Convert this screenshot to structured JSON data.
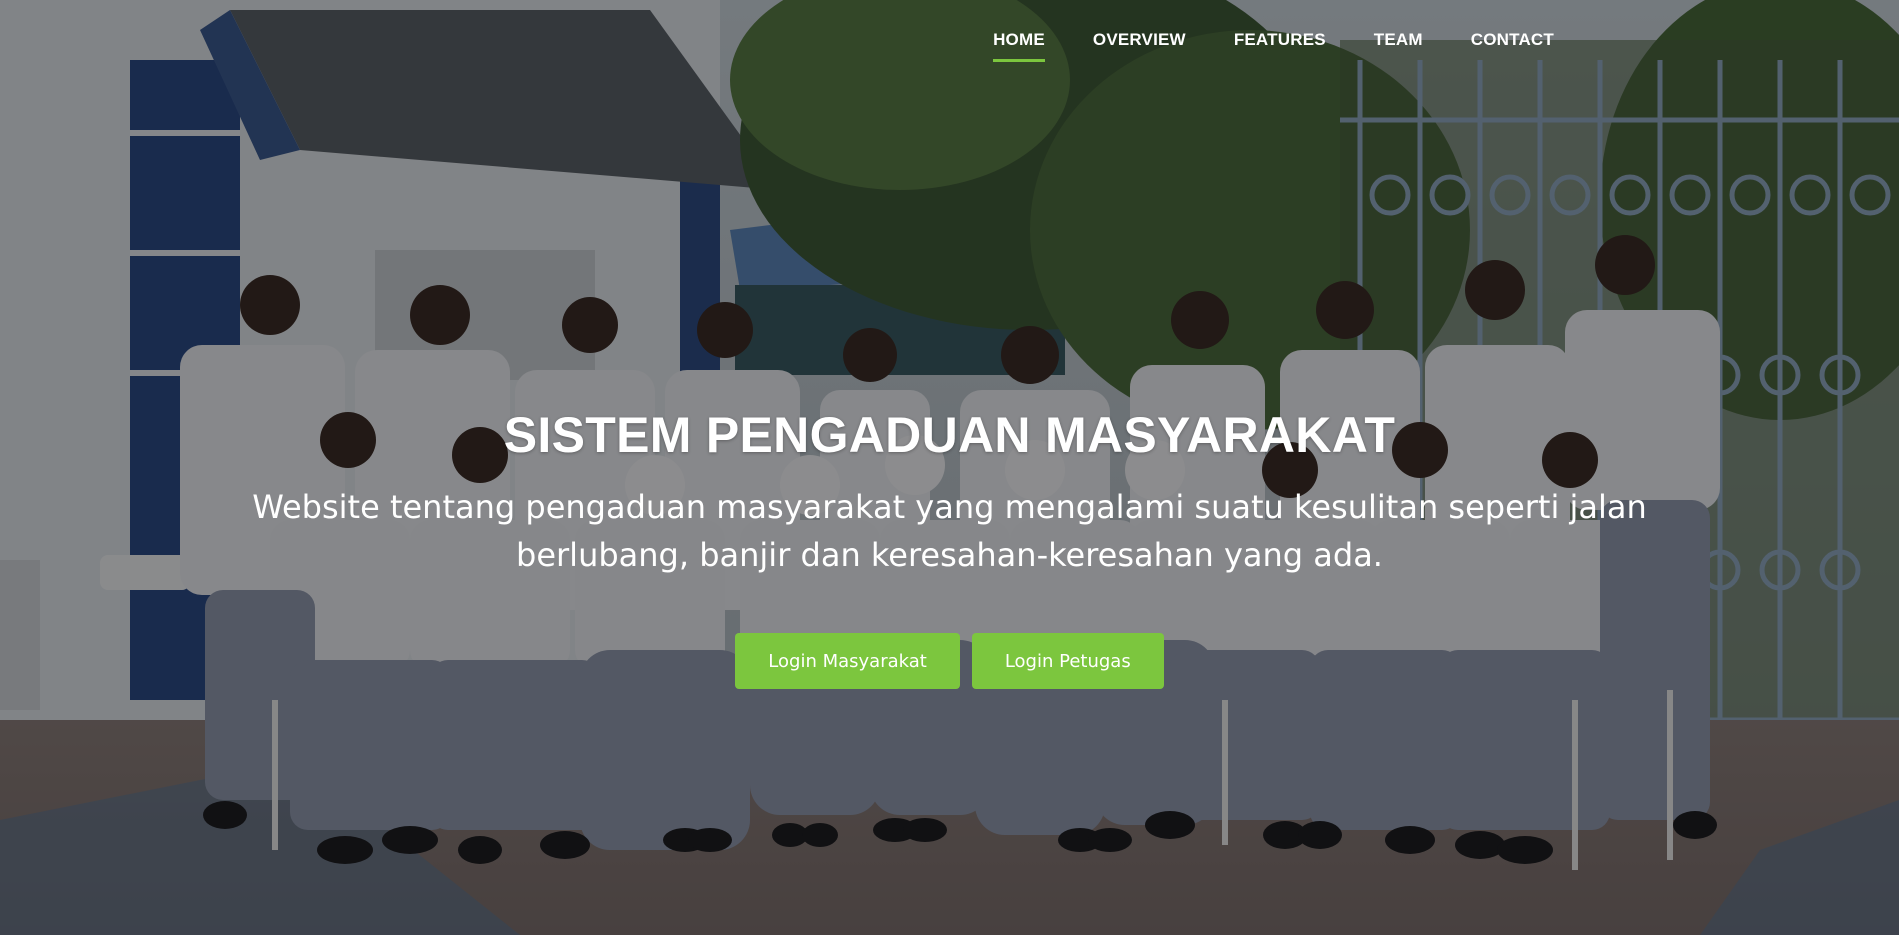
{
  "nav": {
    "items": [
      {
        "label": "HOME",
        "active": true
      },
      {
        "label": "OVERVIEW",
        "active": false
      },
      {
        "label": "FEATURES",
        "active": false
      },
      {
        "label": "TEAM",
        "active": false
      },
      {
        "label": "CONTACT",
        "active": false
      }
    ]
  },
  "hero": {
    "title": "SISTEM PENGADUAN MASYARAKAT",
    "subtitle": "Website tentang pengaduan masyarakat yang mengalami suatu kesulitan seperti jalan berlubang, banjir dan keresahan-keresahan yang ada.",
    "buttons": {
      "masyarakat": "Login Masyarakat",
      "petugas": "Login Petugas"
    }
  },
  "colors": {
    "accent": "#7cc63e",
    "overlay": "rgba(0,0,0,0.42)"
  }
}
